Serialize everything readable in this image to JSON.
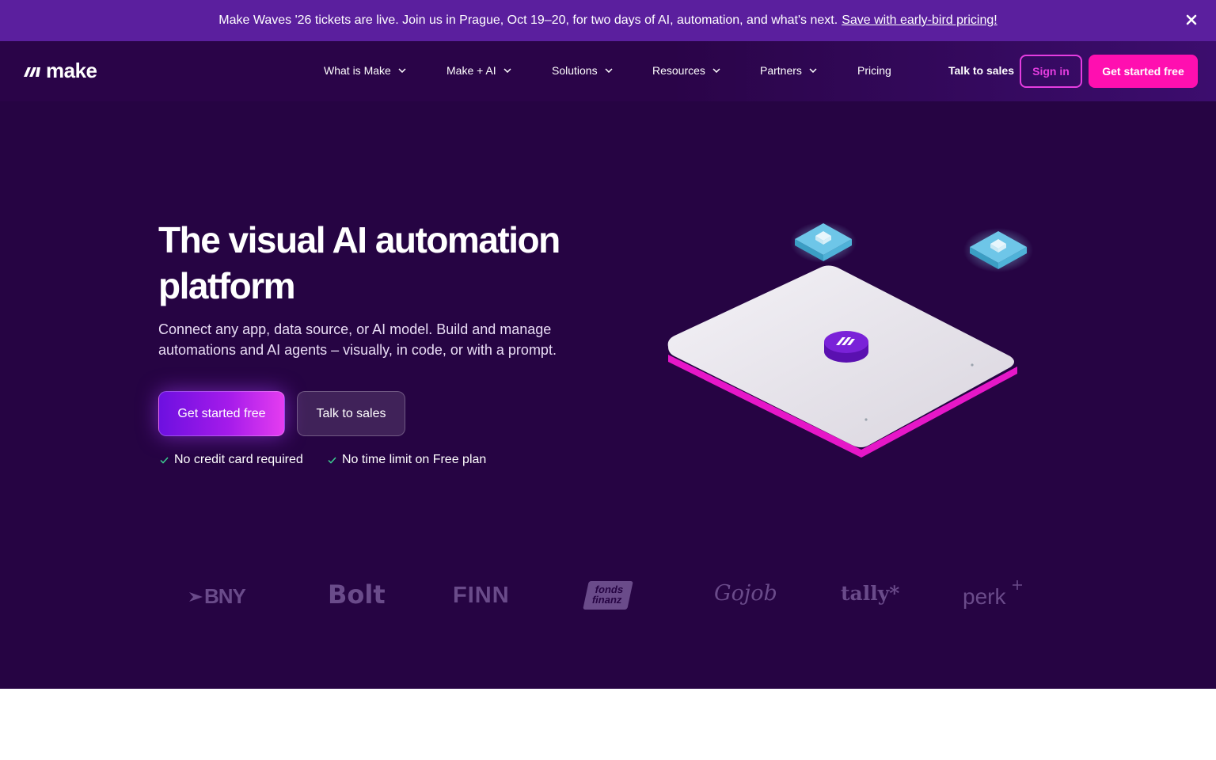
{
  "banner": {
    "text": "Make Waves '26 tickets are live. Join us in Prague, Oct 19–20, for two days of AI, automation, and what's next.",
    "link": "Save with early-bird pricing!",
    "close_icon": "close-icon"
  },
  "nav": {
    "logo_text": "make",
    "items": [
      {
        "label": "What is Make",
        "dropdown": true
      },
      {
        "label": "Make + AI",
        "dropdown": true
      },
      {
        "label": "Solutions",
        "dropdown": true
      },
      {
        "label": "Resources",
        "dropdown": true
      },
      {
        "label": "Partners",
        "dropdown": true
      },
      {
        "label": "Pricing",
        "dropdown": false
      }
    ],
    "talk_to_sales": "Talk to sales",
    "sign_in": "Sign in",
    "get_started": "Get started free"
  },
  "hero": {
    "title": "The visual AI automation platform",
    "subtitle": "Connect any app, data source, or AI model. Build and manage automations and AI agents – visually, in code, or with a prompt.",
    "cta_primary": "Get started free",
    "cta_secondary": "Talk to sales",
    "checks": [
      "No credit card required",
      "No time limit on Free plan"
    ]
  },
  "logos": [
    "BNY",
    "Bolt",
    "FINN",
    "fonds finanz",
    "Gojob",
    "tally*",
    "perk"
  ],
  "colors": {
    "banner_bg": "#5b1f9e",
    "hero_bg": "#260443",
    "accent_pink": "#ff0fb0",
    "accent_magenta": "#e53de0",
    "check_green": "#3ccf91"
  }
}
